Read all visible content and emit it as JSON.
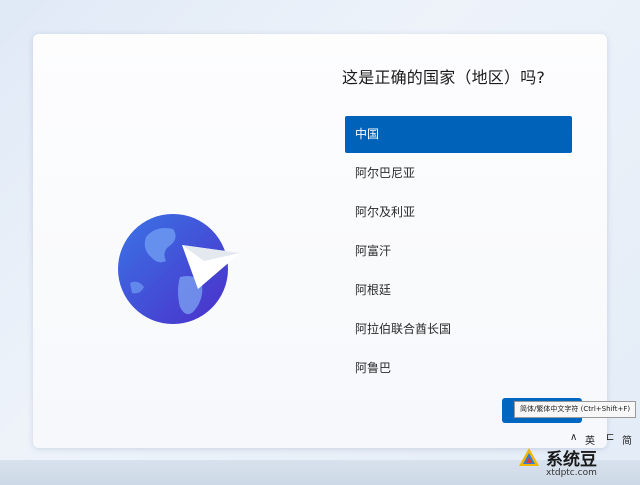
{
  "setup": {
    "title": "这是正确的国家（地区）吗?",
    "regions": [
      "中国",
      "阿尔巴尼亚",
      "阿尔及利亚",
      "阿富汗",
      "阿根廷",
      "阿拉伯联合酋长国",
      "阿鲁巴"
    ],
    "selected_index": 0
  },
  "ime_tooltip": "简体/繁体中文字符 (Ctrl+Shift+F)",
  "taskbar": {
    "items": [
      "∧",
      "英",
      "⊏",
      "简"
    ]
  },
  "watermark": {
    "name": "系统豆",
    "url": "xtdptc.com"
  },
  "colors": {
    "accent": "#0062b8",
    "globe_dark": "#2b4fd6",
    "globe_light": "#5b8cf0"
  },
  "icons": {
    "hero": "globe-paper-plane-icon",
    "logo": "xtdptc-logo-icon"
  }
}
